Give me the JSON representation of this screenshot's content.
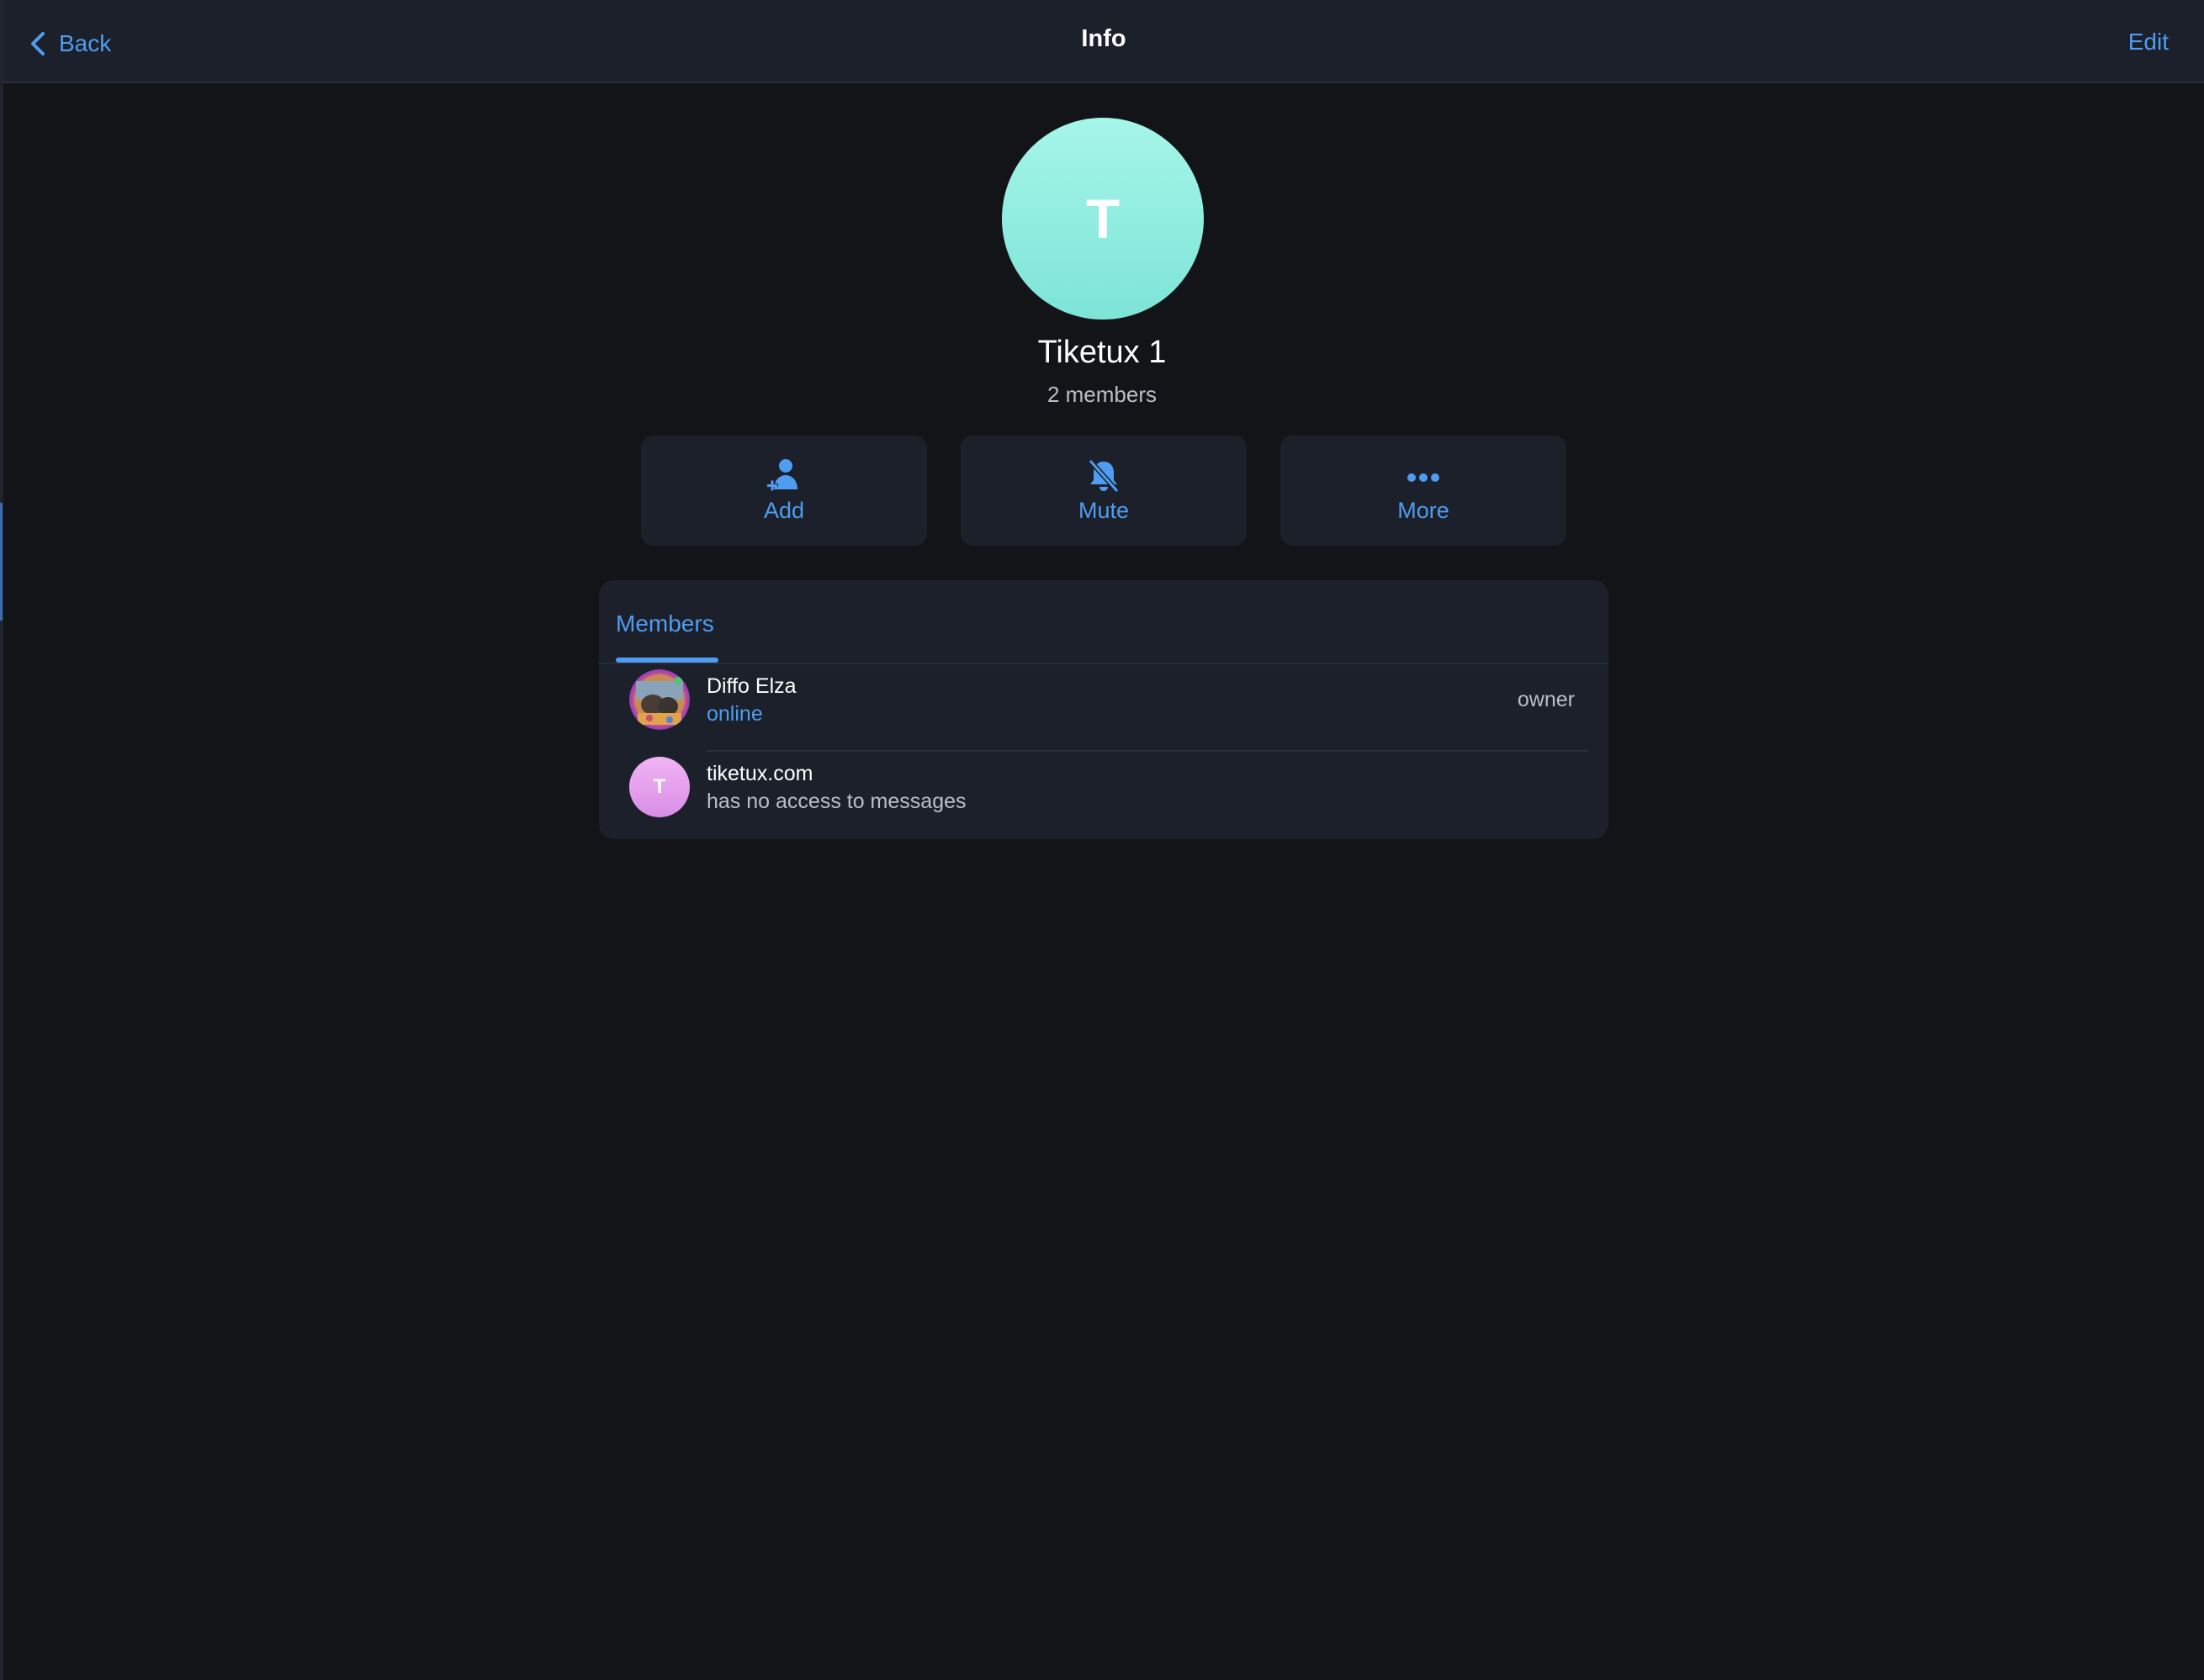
{
  "header": {
    "back_label": "Back",
    "title": "Info",
    "edit_label": "Edit"
  },
  "profile": {
    "avatar_letter": "T",
    "name": "Tiketux 1",
    "member_count": "2 members"
  },
  "actions": [
    {
      "label": "Add",
      "icon": "add-user-icon"
    },
    {
      "label": "Mute",
      "icon": "bell-muted-icon"
    },
    {
      "label": "More",
      "icon": "more-dots-icon"
    }
  ],
  "members_panel": {
    "tab_label": "Members",
    "members": [
      {
        "name": "Diffo Elza",
        "status": "online",
        "role": "owner",
        "avatar": "photo"
      },
      {
        "name": "tiketux.com",
        "status": "has no access to messages",
        "role": "",
        "avatar_letter": "T"
      }
    ]
  },
  "colors": {
    "background": "#131417",
    "surface": "#1b202b",
    "accent": "#4f9cf0",
    "group_avatar": "#8ee9dd",
    "member_avatar": "#e3a0ec"
  }
}
